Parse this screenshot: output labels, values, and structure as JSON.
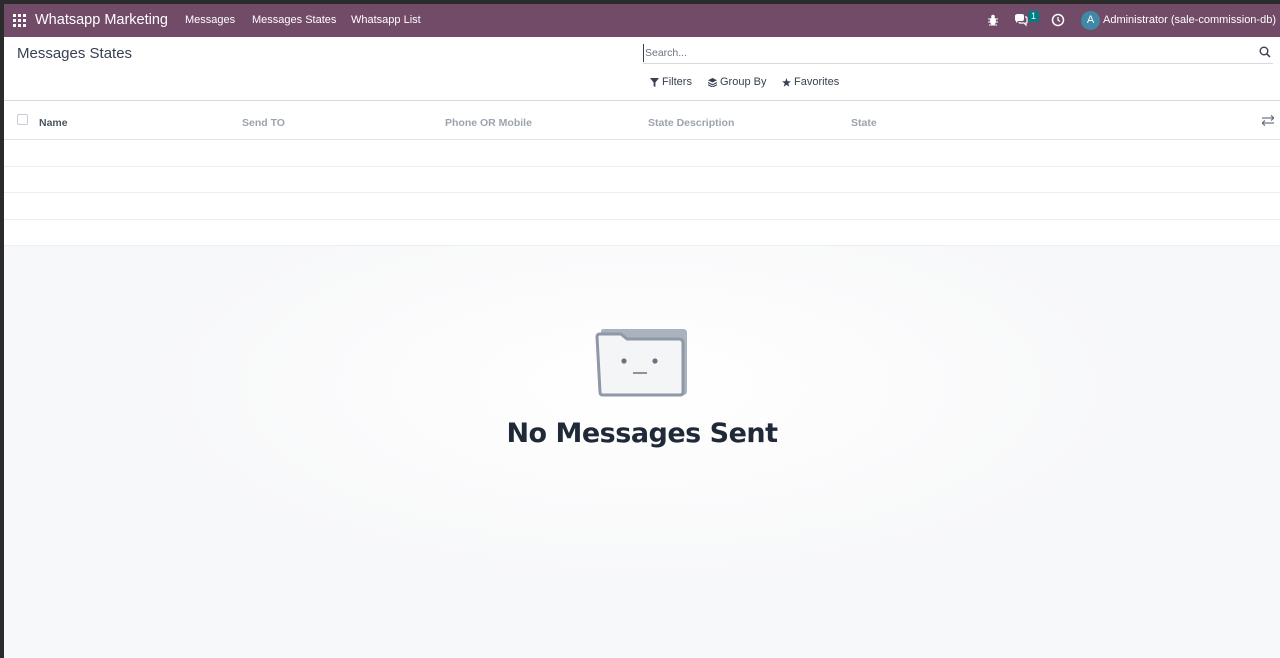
{
  "navbar": {
    "brand": "Whatsapp Marketing",
    "menu": [
      {
        "label": "Messages"
      },
      {
        "label": "Messages States"
      },
      {
        "label": "Whatsapp List"
      }
    ],
    "chat_badge": "1",
    "avatar_letter": "A",
    "user": "Administrator (sale-commission-db)",
    "icons": [
      "apps-grid-icon",
      "bug-icon",
      "chat-icon",
      "clock-icon"
    ]
  },
  "control_panel": {
    "title": "Messages States",
    "search_placeholder": "Search...",
    "filters_label": "Filters",
    "groupby_label": "Group By",
    "favorites_label": "Favorites"
  },
  "list": {
    "columns": [
      "Name",
      "Send TO",
      "Phone OR Mobile",
      "State Description",
      "State"
    ]
  },
  "empty_state": {
    "title": "No Messages Sent"
  },
  "colors": {
    "navbar": "#714b67",
    "badge": "#017e84",
    "avatar": "#3f88a6"
  }
}
